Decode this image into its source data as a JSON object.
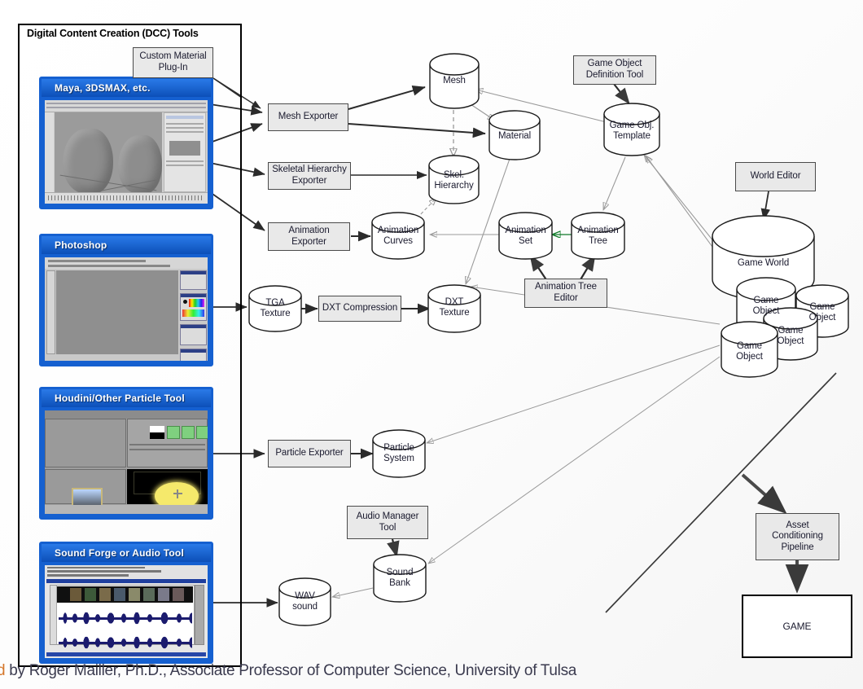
{
  "slide": {
    "caption_lead": "d",
    "caption": " by Roger Mailler, Ph.D., Associate Professor of Computer Science, University of Tulsa"
  },
  "dcc_panel": {
    "title": "Digital Content Creation (DCC) Tools",
    "apps": [
      {
        "name": "maya",
        "title": "Maya, 3DSMAX, etc."
      },
      {
        "name": "photoshop",
        "title": "Photoshop"
      },
      {
        "name": "houdini",
        "title": "Houdini/Other Particle Tool"
      },
      {
        "name": "soundforge",
        "title": "Sound Forge or Audio Tool"
      }
    ]
  },
  "processes": [
    {
      "id": "custom-material-plugin",
      "label": "Custom Material\nPlug-In"
    },
    {
      "id": "mesh-exporter",
      "label": "Mesh Exporter"
    },
    {
      "id": "skeletal-hierarchy-exporter",
      "label": "Skeletal Hierarchy\nExporter"
    },
    {
      "id": "animation-exporter",
      "label": "Animation\nExporter"
    },
    {
      "id": "dxt-compression",
      "label": "DXT Compression"
    },
    {
      "id": "game-object-definition-tool",
      "label": "Game Object\nDefinition Tool"
    },
    {
      "id": "animation-tree-editor",
      "label": "Animation Tree\nEditor"
    },
    {
      "id": "world-editor",
      "label": "World Editor"
    },
    {
      "id": "particle-exporter",
      "label": "Particle Exporter"
    },
    {
      "id": "audio-manager-tool",
      "label": "Audio Manager\nTool"
    },
    {
      "id": "asset-conditioning-pipeline",
      "label": "Asset\nConditioning\nPipeline"
    },
    {
      "id": "game",
      "label": "GAME"
    }
  ],
  "datastores": [
    {
      "id": "mesh",
      "label": "Mesh"
    },
    {
      "id": "material",
      "label": "Material"
    },
    {
      "id": "skel-hierarchy",
      "label": "Skel.\nHierarchy"
    },
    {
      "id": "animation-curves",
      "label": "Animation\nCurves"
    },
    {
      "id": "animation-set",
      "label": "Animation\nSet"
    },
    {
      "id": "animation-tree",
      "label": "Animation\nTree"
    },
    {
      "id": "game-obj-template",
      "label": "Game Obj.\nTemplate"
    },
    {
      "id": "tga-texture",
      "label": "TGA\nTexture"
    },
    {
      "id": "dxt-texture",
      "label": "DXT\nTexture"
    },
    {
      "id": "particle-system",
      "label": "Particle\nSystem"
    },
    {
      "id": "sound-bank",
      "label": "Sound\nBank"
    },
    {
      "id": "wav-sound",
      "label": "WAV\nsound"
    },
    {
      "id": "game-world",
      "label": "Game World"
    },
    {
      "id": "game-object-1",
      "label": "Game\nObject"
    },
    {
      "id": "game-object-2",
      "label": "Game\nObject"
    },
    {
      "id": "game-object-3",
      "label": "Game\nObject"
    },
    {
      "id": "game-object-4",
      "label": "Game\nObject"
    }
  ],
  "colors": {
    "process_fill": "#e9e9e9",
    "stroke_dark": "#2b2b2b",
    "stroke_light": "#9a9a9a",
    "green_arrow": "#0f7a28",
    "panel_blue": "#1560d0",
    "caption_text": "#3b3b4f"
  }
}
